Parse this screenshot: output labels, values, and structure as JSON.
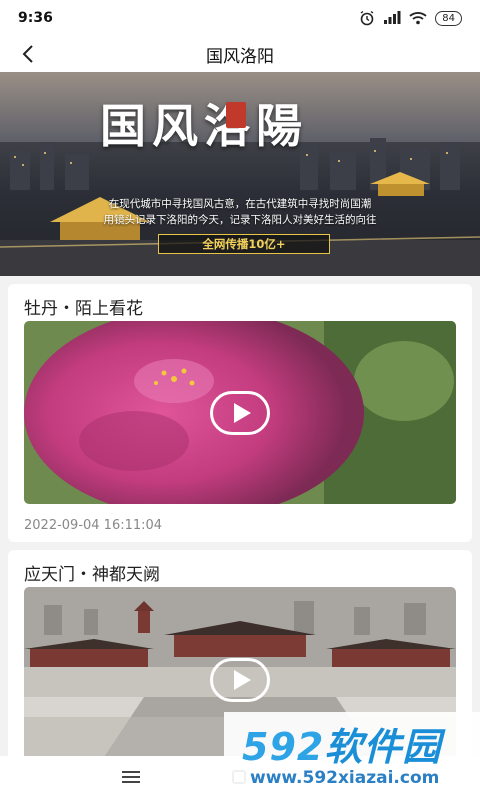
{
  "status_bar": {
    "time": "9:36",
    "battery": "84"
  },
  "header": {
    "title": "国风洛阳"
  },
  "banner": {
    "title": "国风洛陽",
    "desc_line1": "在现代城市中寻找国风古意，在古代建筑中寻找时尚国潮",
    "desc_line2": "用镜头记录下洛阳的今天，记录下洛阳人对美好生活的向往",
    "badge": "全网传播10亿+"
  },
  "videos": [
    {
      "title": "牡丹・陌上看花",
      "date": "2022-09-04 16:11:04"
    },
    {
      "title": "应天门・神都天阙"
    }
  ],
  "watermark": {
    "brand_num": "592",
    "brand_cn": "软件园",
    "url": "www.592xiazai.com"
  }
}
